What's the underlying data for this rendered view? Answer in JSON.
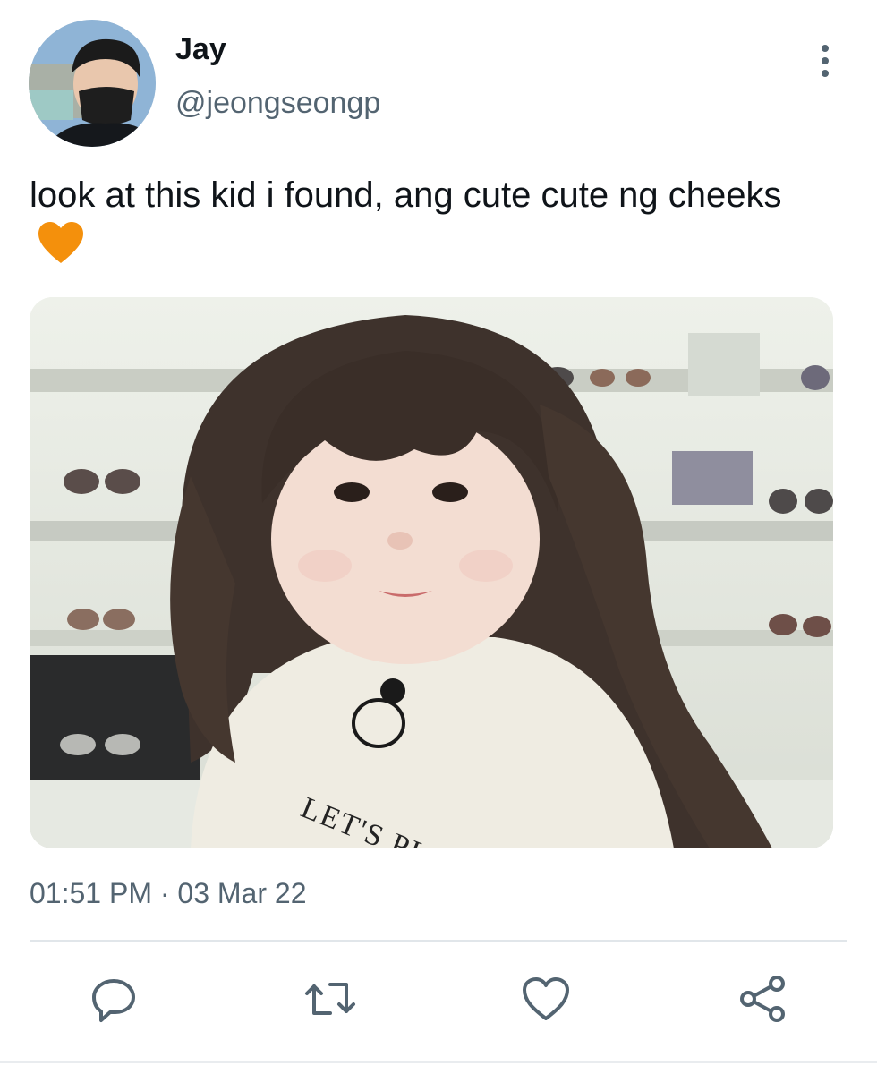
{
  "tweet": {
    "author": {
      "name": "Jay",
      "handle": "@jeongseongp"
    },
    "text": "look at this kid i found, ang cute cute ng cheeks",
    "timestamp": "01:51 PM · 03 Mar 22",
    "shirt_text": "LET'S PL"
  },
  "icons": {
    "more": "more-vertical-icon",
    "reply": "reply-icon",
    "retweet": "retweet-icon",
    "like": "like-icon",
    "share": "share-icon",
    "emoji": "orange-heart-emoji"
  },
  "colors": {
    "text": "#0f1419",
    "secondary": "#536471",
    "divider": "#e1e6ea",
    "emoji": "#f4900c"
  }
}
